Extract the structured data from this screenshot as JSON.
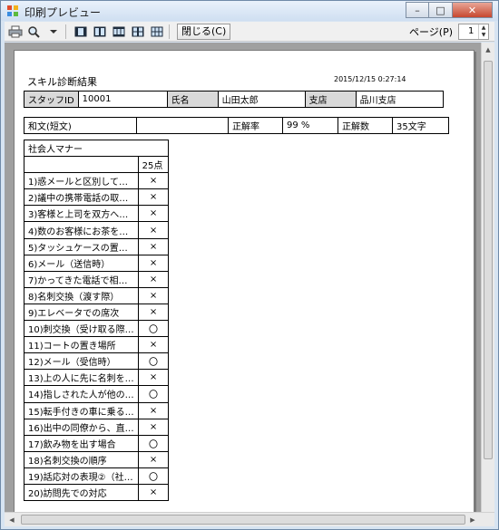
{
  "window": {
    "title": "印刷プレビュー",
    "controls": {
      "minimize": "–",
      "maximize": "□",
      "close": "✕"
    }
  },
  "toolbar": {
    "close_label": "閉じる(C)",
    "page_label": "ページ(P)",
    "page_value": "1"
  },
  "report": {
    "title": "スキル診断結果",
    "date": "2015/12/15 0:27:14",
    "staff_id_label": "スタッフID",
    "staff_id_value": "10001",
    "name_label": "氏名",
    "name_value": "山田太郎",
    "branch_label": "支店",
    "branch_value": "品川支店",
    "category": "和文(短文)",
    "category_value": "",
    "rate_label": "正解率",
    "rate_value": "99 %",
    "count_label": "正解数",
    "count_value": "35文字",
    "section": "社会人マナー",
    "score": "25点",
    "items": [
      {
        "q": "1)惑メールと区別して…",
        "mark": "×"
      },
      {
        "q": "2)議中の携帯電話の取…",
        "mark": "×"
      },
      {
        "q": "3)客様と上司を双方へ…",
        "mark": "×"
      },
      {
        "q": "4)数のお客様にお茶を…",
        "mark": "×"
      },
      {
        "q": "5)タッシュケースの置…",
        "mark": "×"
      },
      {
        "q": "6)メール（送信時）",
        "mark": "×"
      },
      {
        "q": "7)かってきた電話で相…",
        "mark": "×"
      },
      {
        "q": "8)名刺交換（渡す際）",
        "mark": "×"
      },
      {
        "q": "9)エレベータでの席次",
        "mark": "×"
      },
      {
        "q": "10)刺交換（受け取る際…",
        "mark": "〇"
      },
      {
        "q": "11)コートの置き場所",
        "mark": "×"
      },
      {
        "q": "12)メール（受信時）",
        "mark": "〇"
      },
      {
        "q": "13)上の人に先に名刺を…",
        "mark": "×"
      },
      {
        "q": "14)指しされた人が他の…",
        "mark": "〇"
      },
      {
        "q": "15)転手付きの車に乗る…",
        "mark": "×"
      },
      {
        "q": "16)出中の同僚から、直…",
        "mark": "×"
      },
      {
        "q": "17)飲み物を出す場合",
        "mark": "〇"
      },
      {
        "q": "18)名刺交換の順序",
        "mark": "×"
      },
      {
        "q": "19)話応対の表現②（社…",
        "mark": "〇"
      },
      {
        "q": "20)訪問先での対応",
        "mark": "×"
      }
    ]
  }
}
